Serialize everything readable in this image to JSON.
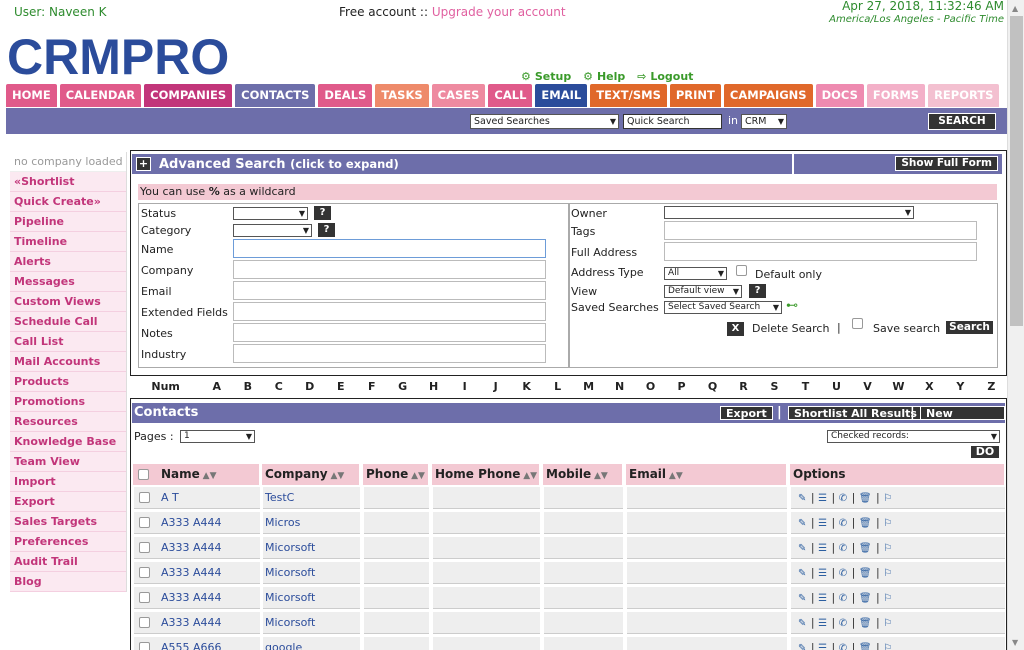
{
  "header": {
    "user_label": "User: Naveen K",
    "account_text": "Free account :: ",
    "upgrade_link": "Upgrade your account",
    "date": "Apr 27, 2018, 11:32:46 AM",
    "timezone": "America/Los Angeles - Pacific Time",
    "logo": "CRMPRO",
    "links": {
      "setup": "Setup",
      "help": "Help",
      "logout": "Logout"
    }
  },
  "tabs": [
    {
      "label": "HOME",
      "color": "#e05a8a"
    },
    {
      "label": "CALENDAR",
      "color": "#e05a8a"
    },
    {
      "label": "COMPANIES",
      "color": "#c2357a"
    },
    {
      "label": "CONTACTS",
      "color": "#6d6eaa"
    },
    {
      "label": "DEALS",
      "color": "#e05a8a"
    },
    {
      "label": "TASKS",
      "color": "#ee8a6a"
    },
    {
      "label": "CASES",
      "color": "#ee8aa0"
    },
    {
      "label": "CALL",
      "color": "#e05a8a"
    },
    {
      "label": "EMAIL",
      "color": "#2b4c9b"
    },
    {
      "label": "TEXT/SMS",
      "color": "#e0682a"
    },
    {
      "label": "PRINT",
      "color": "#e0682a"
    },
    {
      "label": "CAMPAIGNS",
      "color": "#e0682a"
    },
    {
      "label": "DOCS",
      "color": "#ee8ab0"
    },
    {
      "label": "FORMS",
      "color": "#f3b0c8"
    },
    {
      "label": "REPORTS",
      "color": "#f3c0d0"
    }
  ],
  "searchbar": {
    "saved_searches": "Saved Searches",
    "quick_search_placeholder": "Quick Search",
    "in_label": "in",
    "scope": "CRM",
    "search_button": "SEARCH"
  },
  "sidebar": {
    "items": [
      "no company loaded",
      "«Shortlist",
      "Quick Create»",
      "Pipeline",
      "Timeline",
      "Alerts",
      "Messages",
      "Custom Views",
      "Schedule Call",
      "Call List",
      "Mail Accounts",
      "Products",
      "Promotions",
      "Resources",
      "Knowledge Base",
      "Team View",
      "Import",
      "Export",
      "Sales Targets",
      "Preferences",
      "Audit Trail",
      "Blog"
    ]
  },
  "advanced": {
    "title": "Advanced Search",
    "subtitle": "(click to expand)",
    "show_full": "Show Full Form",
    "wildcard_pre": "You can use ",
    "wildcard_sym": "%",
    "wildcard_post": " as a wildcard",
    "labels": {
      "status": "Status",
      "category": "Category",
      "name": "Name",
      "company": "Company",
      "email": "Email",
      "extended": "Extended Fields",
      "notes": "Notes",
      "industry": "Industry",
      "owner": "Owner",
      "tags": "Tags",
      "full_address": "Full Address",
      "address_type": "Address Type",
      "view": "View",
      "saved_searches": "Saved Searches"
    },
    "address_type_value": "All",
    "default_only": "Default only",
    "view_value": "Default view",
    "saved_search_value": "Select Saved Search",
    "delete_search": "Delete Search",
    "save_search": "Save search",
    "search_button": "Search"
  },
  "alphabet": [
    "Num",
    "A",
    "B",
    "C",
    "D",
    "E",
    "F",
    "G",
    "H",
    "I",
    "J",
    "K",
    "L",
    "M",
    "N",
    "O",
    "P",
    "Q",
    "R",
    "S",
    "T",
    "U",
    "V",
    "W",
    "X",
    "Y",
    "Z"
  ],
  "contacts": {
    "title": "Contacts",
    "export": "Export",
    "shortlist_all": "Shortlist All Results",
    "new_contact": "New Contact",
    "pages_label": "Pages :",
    "page_value": "1",
    "checked_records": "Checked records:",
    "do_button": "DO",
    "columns": [
      "Name",
      "Company",
      "Phone",
      "Home Phone",
      "Mobile",
      "Email",
      "Options"
    ],
    "rows": [
      {
        "name": "A T",
        "company": "TestC"
      },
      {
        "name": "A333 A444",
        "company": "Micros"
      },
      {
        "name": "A333 A444",
        "company": "Micorsoft"
      },
      {
        "name": "A333 A444",
        "company": "Micorsoft"
      },
      {
        "name": "A333 A444",
        "company": "Micorsoft"
      },
      {
        "name": "A333 A444",
        "company": "Micorsoft"
      },
      {
        "name": "A555 A666",
        "company": "google"
      }
    ]
  }
}
